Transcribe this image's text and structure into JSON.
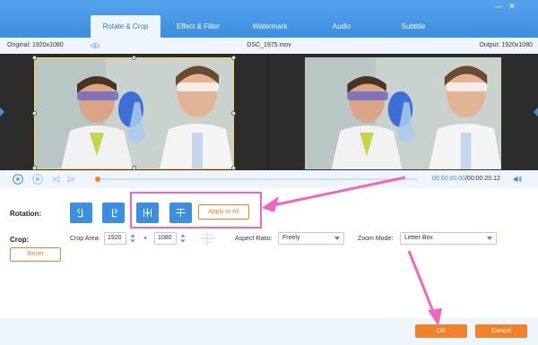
{
  "window": {
    "minimize_label": "—",
    "close_label": "✕"
  },
  "tabs": [
    {
      "label": "Rotate & Crop",
      "active": true
    },
    {
      "label": "Effect & Filter",
      "active": false
    },
    {
      "label": "Watermark",
      "active": false
    },
    {
      "label": "Audio",
      "active": false
    },
    {
      "label": "Subtitle",
      "active": false
    }
  ],
  "info": {
    "original": "Original: 1920x1080",
    "filename": "DSC_1975.mov",
    "output": "Output: 1920x1080"
  },
  "player": {
    "current_time": "00:00:00.00",
    "total_time": "/00:00:20.12",
    "progress_fraction": 0.0
  },
  "rotation": {
    "label": "Rotation:",
    "buttons": [
      "rotate-left-icon",
      "rotate-right-icon",
      "flip-horizontal-icon",
      "flip-vertical-icon"
    ],
    "apply_all_label": "Apply to All"
  },
  "crop": {
    "label": "Crop:",
    "area_label": "Crop Area:",
    "width": "1920",
    "height": "1080",
    "times": "×",
    "aspect_label": "Aspect Ratio:",
    "aspect_value": "Freely",
    "zoom_label": "Zoom Mode:",
    "zoom_value": "Letter Box",
    "reset_label": "Reset"
  },
  "footer": {
    "ok_label": "OK",
    "cancel_label": "Cancel"
  },
  "colors": {
    "accent": "#3b8ee0",
    "orange": "#f0822a",
    "highlight": "#f266c2",
    "crop_border": "#ffd940"
  }
}
